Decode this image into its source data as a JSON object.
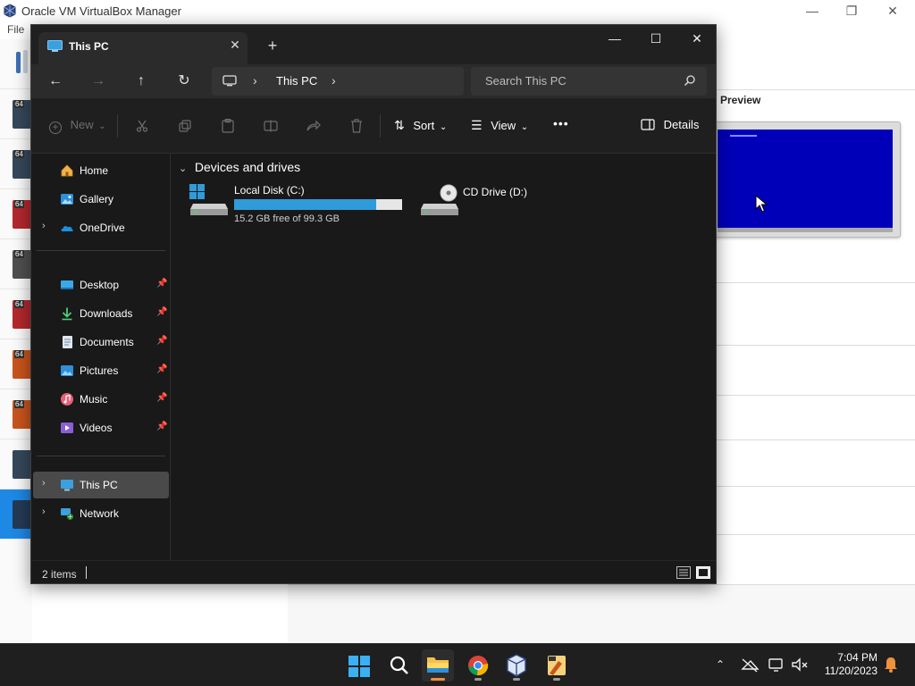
{
  "virtualbox": {
    "title": "Oracle VM VirtualBox Manager",
    "menu_file": "File",
    "preview_label": "Preview",
    "vm_badge": "64",
    "controls": {
      "minimize": "—",
      "maximize": "❐",
      "close": "✕"
    }
  },
  "explorer": {
    "tab_title": "This PC",
    "tab_close": "✕",
    "new_tab": "+",
    "window_controls": {
      "minimize": "—",
      "maximize": "☐",
      "close": "✕"
    },
    "nav": {
      "back": "←",
      "forward": "→",
      "up": "↑",
      "refresh": "↻"
    },
    "address": {
      "separator": "›",
      "crumb": "This PC"
    },
    "search_placeholder": "Search This PC",
    "toolbar": {
      "new_label": "New",
      "sort_label": "Sort",
      "view_label": "View",
      "more_label": "•••",
      "details_label": "Details",
      "dropdown_caret": "⌄"
    },
    "sidebar": {
      "expand_chevron": "›",
      "pin_glyph": "📌",
      "home": "Home",
      "gallery": "Gallery",
      "onedrive": "OneDrive",
      "desktop": "Desktop",
      "downloads": "Downloads",
      "documents": "Documents",
      "pictures": "Pictures",
      "music": "Music",
      "videos": "Videos",
      "this_pc": "This PC",
      "network": "Network"
    },
    "content": {
      "group_chevron": "⌄",
      "group_title": "Devices and drives",
      "drives": [
        {
          "label": "Local Disk (C:)",
          "free_text": "15.2 GB free of 99.3 GB",
          "used_fraction": 0.847
        },
        {
          "label": "CD Drive (D:)"
        }
      ]
    },
    "status": {
      "item_count": "2 items"
    }
  },
  "taskbar": {
    "time": "7:04 PM",
    "date": "11/20/2023",
    "tray_chevron": "⌃"
  },
  "colors": {
    "accent_orange": "#f0913c",
    "progress_blue": "#2f9bd9",
    "preview_blue": "#0000b8",
    "vm_selected": "#1e88e5"
  }
}
